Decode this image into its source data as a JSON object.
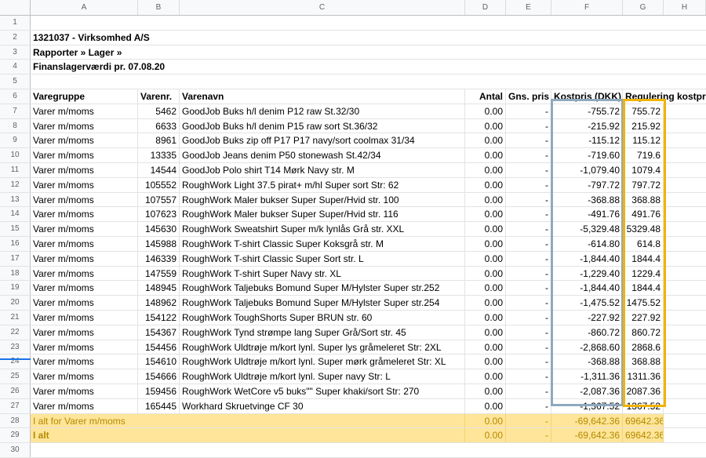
{
  "columns": [
    "A",
    "B",
    "C",
    "D",
    "E",
    "F",
    "G",
    "H"
  ],
  "row_numbers": [
    "1",
    "2",
    "3",
    "4",
    "5",
    "6",
    "7",
    "8",
    "9",
    "10",
    "11",
    "12",
    "13",
    "14",
    "15",
    "16",
    "17",
    "18",
    "19",
    "20",
    "21",
    "22",
    "23",
    "24",
    "25",
    "26",
    "27",
    "28",
    "29",
    "30"
  ],
  "info": {
    "company": "1321037 - Virksomhed A/S",
    "path": "Rapporter » Lager »",
    "report": "Finanslagerværdi pr. 07.08.20"
  },
  "headers": {
    "a": "Varegruppe",
    "b": "Varenr.",
    "c": "Varenavn",
    "d": "Antal",
    "e": "Gns. pris",
    "f": "Kostpris (DKK)",
    "g": "Regulering kostpris"
  },
  "rows": [
    {
      "a": "Varer m/moms",
      "b": "5462",
      "c": "GoodJob  Buks h/l denim P12 raw St.32/30",
      "d": "0.00",
      "e": "-",
      "f": "-755.72",
      "g": "755.72"
    },
    {
      "a": "Varer m/moms",
      "b": "6633",
      "c": "GoodJob  Buks h/l denim P15 raw sort St.36/32",
      "d": "0.00",
      "e": "-",
      "f": "-215.92",
      "g": "215.92"
    },
    {
      "a": "Varer m/moms",
      "b": "8961",
      "c": "GoodJob  Buks zip off P17 P17 navy/sort coolmax 31/34",
      "d": "0.00",
      "e": "-",
      "f": "-115.12",
      "g": "115.12"
    },
    {
      "a": "Varer m/moms",
      "b": "13335",
      "c": "GoodJob  Jeans denim P50 stonewash St.42/34",
      "d": "0.00",
      "e": "-",
      "f": "-719.60",
      "g": "719.6"
    },
    {
      "a": "Varer m/moms",
      "b": "14544",
      "c": "GoodJob  Polo shirt T14 Mørk Navy str. M",
      "d": "0.00",
      "e": "-",
      "f": "-1,079.40",
      "g": "1079.4"
    },
    {
      "a": "Varer m/moms",
      "b": "105552",
      "c": "RoughWork Light 37.5 pirat+ m/hl Super sort Str: 62",
      "d": "0.00",
      "e": "-",
      "f": "-797.72",
      "g": "797.72"
    },
    {
      "a": "Varer m/moms",
      "b": "107557",
      "c": "RoughWork Maler bukser Super Super/Hvid str. 100",
      "d": "0.00",
      "e": "-",
      "f": "-368.88",
      "g": "368.88"
    },
    {
      "a": "Varer m/moms",
      "b": "107623",
      "c": "RoughWork Maler bukser Super Super/Hvid str. 116",
      "d": "0.00",
      "e": "-",
      "f": "-491.76",
      "g": "491.76"
    },
    {
      "a": "Varer m/moms",
      "b": "145630",
      "c": "RoughWork Sweatshirt Super m/k lynlås Grå str. XXL",
      "d": "0.00",
      "e": "-",
      "f": "-5,329.48",
      "g": "5329.48"
    },
    {
      "a": "Varer m/moms",
      "b": "145988",
      "c": "RoughWork T-shirt Classic Super Koksgrå str. M",
      "d": "0.00",
      "e": "-",
      "f": "-614.80",
      "g": "614.8"
    },
    {
      "a": "Varer m/moms",
      "b": "146339",
      "c": "RoughWork T-shirt Classic Super Sort str. L",
      "d": "0.00",
      "e": "-",
      "f": "-1,844.40",
      "g": "1844.4"
    },
    {
      "a": "Varer m/moms",
      "b": "147559",
      "c": "RoughWork T-shirt Super Navy str. XL",
      "d": "0.00",
      "e": "-",
      "f": "-1,229.40",
      "g": "1229.4"
    },
    {
      "a": "Varer m/moms",
      "b": "148945",
      "c": "RoughWork Taljebuks Bomund Super M/Hylster Super str.252",
      "d": "0.00",
      "e": "-",
      "f": "-1,844.40",
      "g": "1844.4"
    },
    {
      "a": "Varer m/moms",
      "b": "148962",
      "c": "RoughWork Taljebuks Bomund Super M/Hylster Super str.254",
      "d": "0.00",
      "e": "-",
      "f": "-1,475.52",
      "g": "1475.52"
    },
    {
      "a": "Varer m/moms",
      "b": "154122",
      "c": "RoughWork ToughShorts Super BRUN str. 60",
      "d": "0.00",
      "e": "-",
      "f": "-227.92",
      "g": "227.92"
    },
    {
      "a": "Varer m/moms",
      "b": "154367",
      "c": "RoughWork Tynd strømpe lang Super Grå/Sort str. 45",
      "d": "0.00",
      "e": "-",
      "f": "-860.72",
      "g": "860.72"
    },
    {
      "a": "Varer m/moms",
      "b": "154456",
      "c": "RoughWork Uldtrøje m/kort lynl. Super lys gråmeleret Str: 2XL",
      "d": "0.00",
      "e": "-",
      "f": "-2,868.60",
      "g": "2868.6"
    },
    {
      "a": "Varer m/moms",
      "b": "154610",
      "c": "RoughWork Uldtrøje m/kort lynl. Super mørk gråmeleret Str: XL",
      "d": "0.00",
      "e": "-",
      "f": "-368.88",
      "g": "368.88"
    },
    {
      "a": "Varer m/moms",
      "b": "154666",
      "c": "RoughWork Uldtrøje m/kort lynl. Super navy Str: L",
      "d": "0.00",
      "e": "-",
      "f": "-1,311.36",
      "g": "1311.36"
    },
    {
      "a": "Varer m/moms",
      "b": "159456",
      "c": "RoughWork WetCore v5 buks\"\" Super khaki/sort Str: 270",
      "d": "0.00",
      "e": "-",
      "f": "-2,087.36",
      "g": "2087.36"
    },
    {
      "a": "Varer m/moms",
      "b": "165445",
      "c": "Workhard Skruetvinge CF 30",
      "d": "0.00",
      "e": "-",
      "f": "-1,367.52",
      "g": "1367.52"
    }
  ],
  "totals": [
    {
      "a": "I alt for Varer m/moms",
      "d": "0.00",
      "e": "-",
      "f": "-69,642.36",
      "g": "69642.36"
    },
    {
      "a": "I alt",
      "d": "0.00",
      "e": "-",
      "f": "-69,642.36",
      "g": "69642.36"
    }
  ],
  "colors": {
    "highlight": "#ffe599",
    "blue_border": "#8ea9bf",
    "orange_border": "#f1b300",
    "selected_row_marker": "#1a73e8"
  }
}
